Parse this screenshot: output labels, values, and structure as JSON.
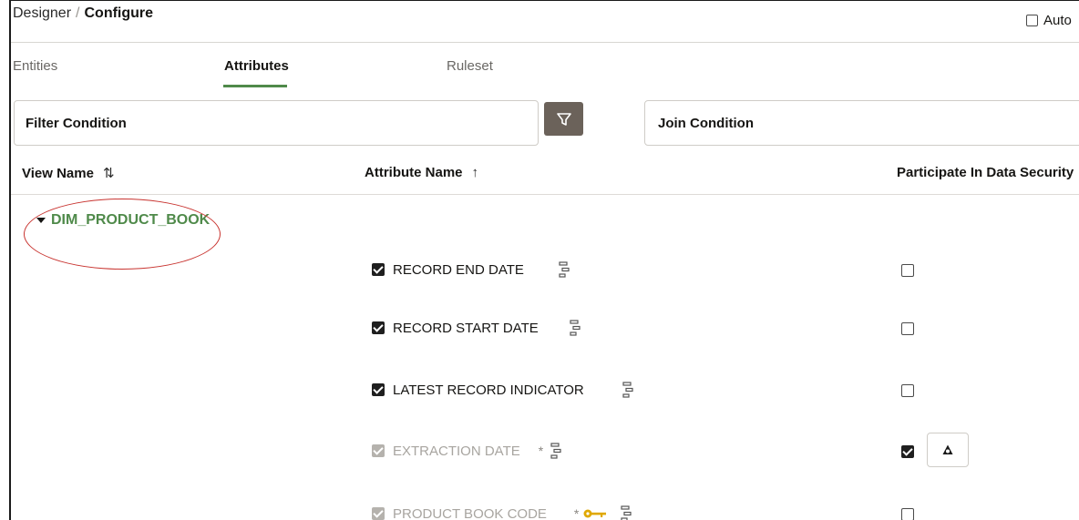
{
  "breadcrumb": {
    "parent": "Designer",
    "separator": "/",
    "current": "Configure"
  },
  "auto_checkbox": {
    "label": "Auto",
    "checked": false
  },
  "tabs": [
    {
      "label": "Entities",
      "active": false
    },
    {
      "label": "Attributes",
      "active": true
    },
    {
      "label": "Ruleset",
      "active": false
    }
  ],
  "filters": {
    "filter_condition": "Filter Condition",
    "join_condition": "Join Condition"
  },
  "columns": {
    "view_name": "View Name",
    "view_name_sort": "⇅",
    "attribute_name": "Attribute Name",
    "attribute_name_sort": "↑",
    "participate": "Participate In Data Security"
  },
  "tree_node": {
    "label": "DIM_PRODUCT_BOOK",
    "expanded": true
  },
  "rows": [
    {
      "label": "RECORD END DATE",
      "checked": true,
      "disabled": false,
      "required": false,
      "key": false,
      "security": false
    },
    {
      "label": "RECORD START DATE",
      "checked": true,
      "disabled": false,
      "required": false,
      "key": false,
      "security": false
    },
    {
      "label": "LATEST RECORD INDICATOR",
      "checked": true,
      "disabled": false,
      "required": false,
      "key": false,
      "security": false
    },
    {
      "label": "EXTRACTION DATE",
      "checked": true,
      "disabled": true,
      "required": true,
      "required_mark": "*",
      "key": false,
      "security": true
    },
    {
      "label": "PRODUCT BOOK CODE",
      "checked": true,
      "disabled": true,
      "required": true,
      "required_mark": "*",
      "key": true,
      "security": false
    }
  ],
  "icons": {
    "filter": "funnel-icon",
    "hierarchy": "hierarchy-icon",
    "key": "key-icon",
    "security": "data-security-icon"
  },
  "colors": {
    "accent_green": "#4f8a4a",
    "filter_button": "#6b625a",
    "annotation_red": "#c8332f",
    "key_gold": "#e0a800"
  }
}
